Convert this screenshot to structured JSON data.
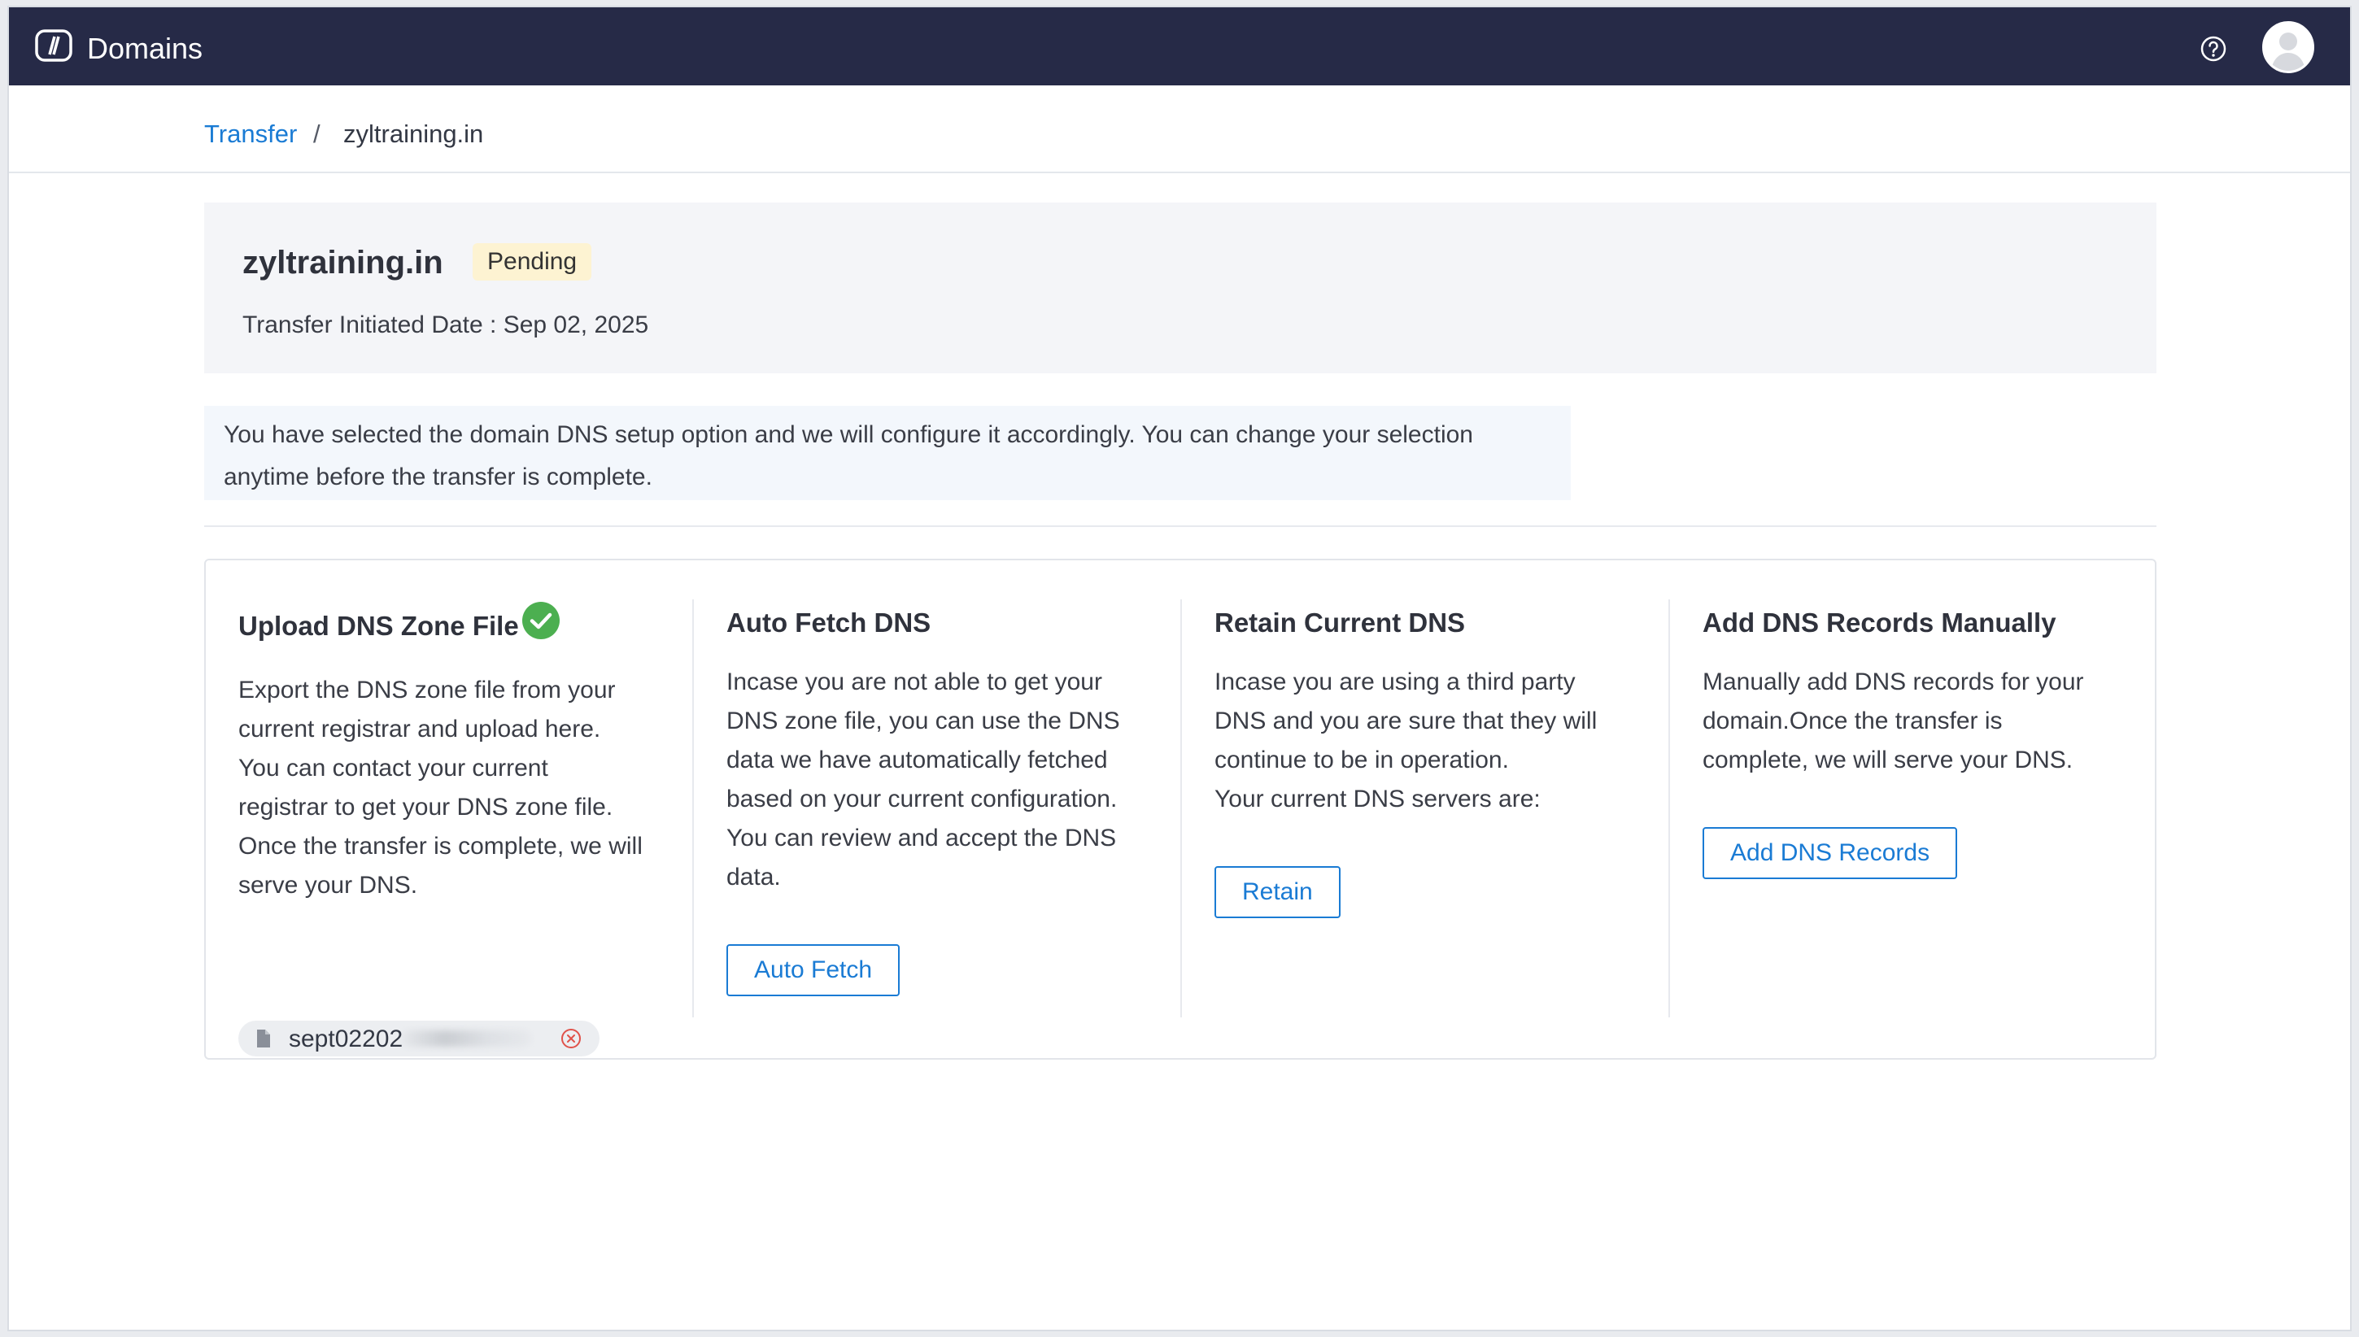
{
  "app": {
    "title": "Domains"
  },
  "breadcrumb": {
    "parent": "Transfer",
    "separator": "/",
    "current": "zyltraining.in"
  },
  "domain": {
    "name": "zyltraining.in",
    "status": "Pending",
    "initiated_label": "Transfer Initiated Date : Sep 02, 2025"
  },
  "info": {
    "line1": "You have selected the domain DNS setup option and we will configure it accordingly. You can change your selection",
    "line2": "anytime before the transfer is complete."
  },
  "options": {
    "upload": {
      "title": "Upload DNS Zone File",
      "lines": [
        "Export the DNS zone file from your",
        "current registrar and upload here.",
        "You can contact your current",
        "registrar to get your DNS zone file.",
        "Once the transfer is complete, we will",
        "serve your DNS."
      ],
      "file_name": "sept02202"
    },
    "autofetch": {
      "title": "Auto Fetch DNS",
      "lines": [
        "Incase you are not able to get your",
        "DNS zone file, you can use the DNS",
        "data we have automatically fetched",
        "based on your current configuration.",
        "You can review and accept the DNS",
        "data."
      ],
      "button": "Auto Fetch"
    },
    "retain": {
      "title": "Retain Current DNS",
      "lines": [
        "Incase you are using a third party",
        "DNS and you are sure that they will",
        "continue to be in operation.",
        "Your current DNS servers are:"
      ],
      "button": "Retain"
    },
    "manual": {
      "title": "Add DNS Records Manually",
      "lines": [
        "Manually add DNS records for your",
        "domain.Once the transfer is",
        "complete, we will serve your DNS."
      ],
      "button": "Add DNS Records"
    }
  },
  "icons": {
    "logo": "domains-logo-icon",
    "help": "help-icon",
    "avatar": "avatar",
    "check": "check-circle-icon",
    "file": "file-icon",
    "remove": "remove-file-icon"
  },
  "colors": {
    "topbar": "#262a47",
    "accent": "#1a7bd4",
    "success": "#4caf50",
    "pending_badge": "#fdf3d2",
    "danger": "#e0524a"
  }
}
